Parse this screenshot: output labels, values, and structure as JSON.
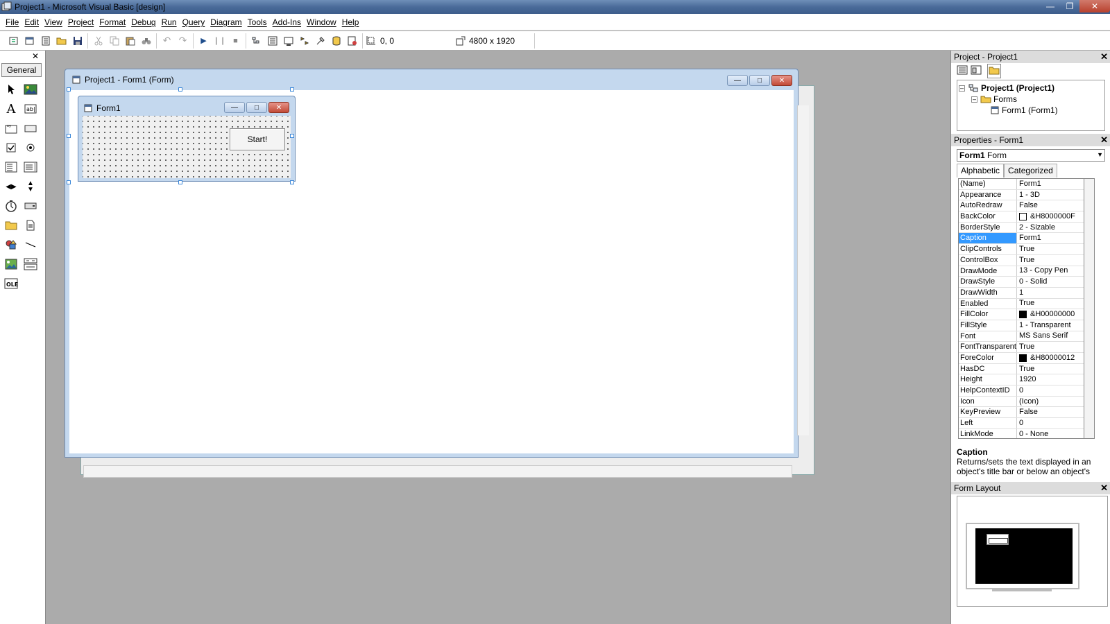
{
  "window": {
    "title": "Project1 - Microsoft Visual Basic [design]"
  },
  "menu": [
    "File",
    "Edit",
    "View",
    "Project",
    "Format",
    "Debug",
    "Run",
    "Query",
    "Diagram",
    "Tools",
    "Add-Ins",
    "Window",
    "Help"
  ],
  "toolbar": {
    "position": "0, 0",
    "size": "4800 x 1920"
  },
  "toolbox": {
    "tab": "General"
  },
  "designer": {
    "title": "Project1 - Form1 (Form)"
  },
  "form": {
    "caption": "Form1",
    "button_label": "Start!"
  },
  "project": {
    "title": "Project - Project1",
    "root": "Project1 (Project1)",
    "folder": "Forms",
    "item": "Form1 (Form1)"
  },
  "properties": {
    "title": "Properties - Form1",
    "object_name": "Form1",
    "object_type": "Form",
    "tabs": [
      "Alphabetic",
      "Categorized"
    ],
    "rows": [
      {
        "name": "(Name)",
        "value": "Form1"
      },
      {
        "name": "Appearance",
        "value": "1 - 3D"
      },
      {
        "name": "AutoRedraw",
        "value": "False"
      },
      {
        "name": "BackColor",
        "value": "&H8000000F",
        "swatch": "#ffffff"
      },
      {
        "name": "BorderStyle",
        "value": "2 - Sizable"
      },
      {
        "name": "Caption",
        "value": "Form1"
      },
      {
        "name": "ClipControls",
        "value": "True"
      },
      {
        "name": "ControlBox",
        "value": "True"
      },
      {
        "name": "DrawMode",
        "value": "13 - Copy Pen"
      },
      {
        "name": "DrawStyle",
        "value": "0 - Solid"
      },
      {
        "name": "DrawWidth",
        "value": "1"
      },
      {
        "name": "Enabled",
        "value": "True"
      },
      {
        "name": "FillColor",
        "value": "&H00000000",
        "swatch": "#000000"
      },
      {
        "name": "FillStyle",
        "value": "1 - Transparent"
      },
      {
        "name": "Font",
        "value": "MS Sans Serif"
      },
      {
        "name": "FontTransparent",
        "value": "True"
      },
      {
        "name": "ForeColor",
        "value": "&H80000012",
        "swatch": "#000000"
      },
      {
        "name": "HasDC",
        "value": "True"
      },
      {
        "name": "Height",
        "value": "1920"
      },
      {
        "name": "HelpContextID",
        "value": "0"
      },
      {
        "name": "Icon",
        "value": "(Icon)"
      },
      {
        "name": "KeyPreview",
        "value": "False"
      },
      {
        "name": "Left",
        "value": "0"
      },
      {
        "name": "LinkMode",
        "value": "0 - None"
      }
    ],
    "selected": "Caption",
    "desc_title": "Caption",
    "desc_text": "Returns/sets the text displayed in an object's title bar or below an object's"
  },
  "layout": {
    "title": "Form Layout"
  }
}
